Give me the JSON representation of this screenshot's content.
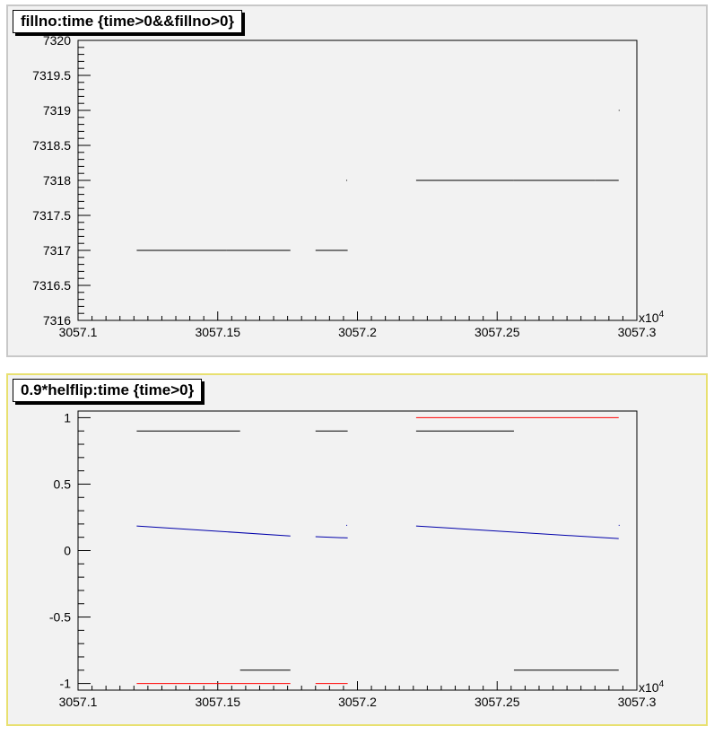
{
  "chart_data": [
    {
      "type": "scatter",
      "title": "fillno:time {time>0&&fillno>0}",
      "x_multiplier_label": "x10",
      "x_multiplier_exp": "4",
      "xlim": [
        3057.1,
        3057.3
      ],
      "ylim": [
        7316,
        7320
      ],
      "xticks": [
        "3057.1",
        "3057.15",
        "3057.2",
        "3057.25",
        "3057.3"
      ],
      "yticks": [
        "7316",
        "7316.5",
        "7317",
        "7317.5",
        "7318",
        "7318.5",
        "7319",
        "7319.5",
        "7320"
      ],
      "series": [
        {
          "color": "#000000",
          "segments": [
            {
              "x": [
                3057.121,
                3057.153
              ],
              "y": [
                7317,
                7317
              ]
            },
            {
              "x": [
                3057.153,
                3057.176
              ],
              "y": [
                7317,
                7317
              ]
            },
            {
              "x": [
                3057.185,
                3057.1965
              ],
              "y": [
                7317,
                7317
              ]
            },
            {
              "x": [
                3057.196,
                3057.196
              ],
              "y": [
                7318,
                7318
              ]
            },
            {
              "x": [
                3057.221,
                3057.256
              ],
              "y": [
                7318,
                7318
              ]
            },
            {
              "x": [
                3057.256,
                3057.285
              ],
              "y": [
                7318,
                7318
              ]
            },
            {
              "x": [
                3057.285,
                3057.2935
              ],
              "y": [
                7318,
                7318
              ]
            },
            {
              "x": [
                3057.2935,
                3057.2935
              ],
              "y": [
                7319,
                7319
              ]
            }
          ]
        }
      ]
    },
    {
      "type": "scatter",
      "title": "0.9*helflip:time {time>0}",
      "x_multiplier_label": "x10",
      "x_multiplier_exp": "4",
      "xlim": [
        3057.1,
        3057.3
      ],
      "ylim": [
        -1.05,
        1.05
      ],
      "xticks": [
        "3057.1",
        "3057.15",
        "3057.2",
        "3057.25",
        "3057.3"
      ],
      "yticks": [
        "-1",
        "-0.5",
        "0",
        "0.5",
        "1"
      ],
      "series": [
        {
          "color": "#000000",
          "segments": [
            {
              "x": [
                3057.121,
                3057.158
              ],
              "y": [
                0.9,
                0.9
              ]
            },
            {
              "x": [
                3057.158,
                3057.176
              ],
              "y": [
                -0.9,
                -0.9
              ]
            },
            {
              "x": [
                3057.185,
                3057.1965
              ],
              "y": [
                0.9,
                0.9
              ]
            },
            {
              "x": [
                3057.221,
                3057.256
              ],
              "y": [
                0.9,
                0.9
              ]
            },
            {
              "x": [
                3057.256,
                3057.2935
              ],
              "y": [
                -0.9,
                -0.9
              ]
            }
          ]
        },
        {
          "color": "#ff0000",
          "segments": [
            {
              "x": [
                3057.121,
                3057.176
              ],
              "y": [
                -1,
                -1
              ]
            },
            {
              "x": [
                3057.185,
                3057.1965
              ],
              "y": [
                -1,
                -1
              ]
            },
            {
              "x": [
                3057.221,
                3057.2935
              ],
              "y": [
                1,
                1
              ]
            }
          ]
        },
        {
          "color": "#0000aa",
          "segments": [
            {
              "x": [
                3057.121,
                3057.176
              ],
              "y": [
                0.185,
                0.11
              ]
            },
            {
              "x": [
                3057.185,
                3057.1965
              ],
              "y": [
                0.105,
                0.095
              ]
            },
            {
              "x": [
                3057.196,
                3057.196
              ],
              "y": [
                0.19,
                0.19
              ]
            },
            {
              "x": [
                3057.221,
                3057.2935
              ],
              "y": [
                0.185,
                0.09
              ]
            },
            {
              "x": [
                3057.2935,
                3057.2935
              ],
              "y": [
                0.19,
                0.19
              ]
            }
          ]
        }
      ]
    }
  ]
}
